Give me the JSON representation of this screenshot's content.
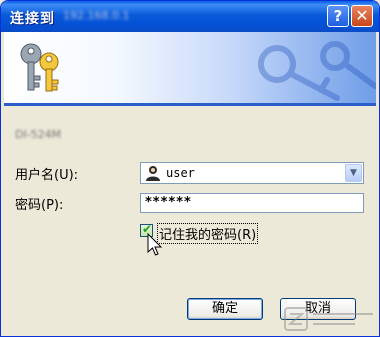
{
  "window": {
    "title": "连接到",
    "title_obscured": "192.168.0.1",
    "help_glyph": "?",
    "close_glyph": "✕"
  },
  "icons": {
    "banner": "keys-icon",
    "user": "user-icon",
    "dropdown": "chevron-down-icon",
    "cursor": "mouse-pointer-icon"
  },
  "dialog": {
    "obscured_text": "DI-524M",
    "username_label": "用户名(U):",
    "username_value": "user",
    "password_label": "密码(P):",
    "password_mask": "******",
    "remember_label": "记住我的密码(R)",
    "remember_checked": true,
    "ok_label": "确定",
    "cancel_label": "取消"
  },
  "colors": {
    "titlebar": "#0a5ad8",
    "dialog_bg": "#ece9d8",
    "button_border": "#003c74"
  }
}
